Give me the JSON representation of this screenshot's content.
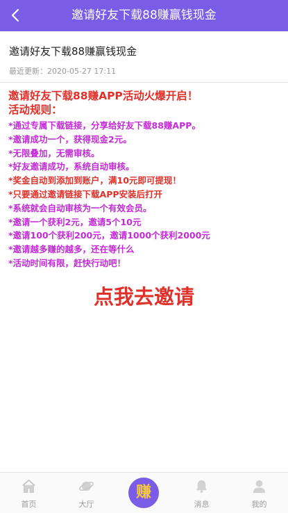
{
  "header": {
    "title": "邀请好友下载88赚赢钱现金",
    "back_icon": "chevron-left-icon"
  },
  "article": {
    "title": "邀请好友下载88赚赢钱现金",
    "updated": "最近更新：2020-05-27 17:11"
  },
  "content": {
    "headline": [
      "邀请好友下载88赚APP活动火爆开启！",
      "活动规则："
    ],
    "rules": [
      "*通过专属下载链接，分享给好友下载88赚APP。",
      "*邀请成功一个，获得现金2元。",
      "*无限叠加，无需审核。",
      "*好友邀请成功，系统自动审核。",
      "*奖金自动到添加到账户，满10元即可提现！",
      "*只要通过邀请链接下载APP安装后打开",
      "*系统就会自动审核为一个有效会员。",
      "*邀请一个获利2元，邀请5个10元",
      "*邀请100个获利200元，邀请1000个获利2000元",
      "*邀请越多赚的越多，还在等什么",
      "*活动时间有限，赶快行动吧！"
    ],
    "cta": "点我去邀请"
  },
  "tabbar": {
    "items": [
      {
        "label": "首页",
        "icon": "home-icon"
      },
      {
        "label": "大厅",
        "icon": "planet-icon"
      },
      {
        "label": "赚",
        "icon": "earn-icon"
      },
      {
        "label": "消息",
        "icon": "bell-icon"
      },
      {
        "label": "我的",
        "icon": "user-icon"
      }
    ]
  },
  "colors": {
    "primary": "#7b5ce6",
    "headline_red": "#e0302a",
    "rule_purple": "#c22bd6",
    "earn_gold": "#f7c83b"
  }
}
